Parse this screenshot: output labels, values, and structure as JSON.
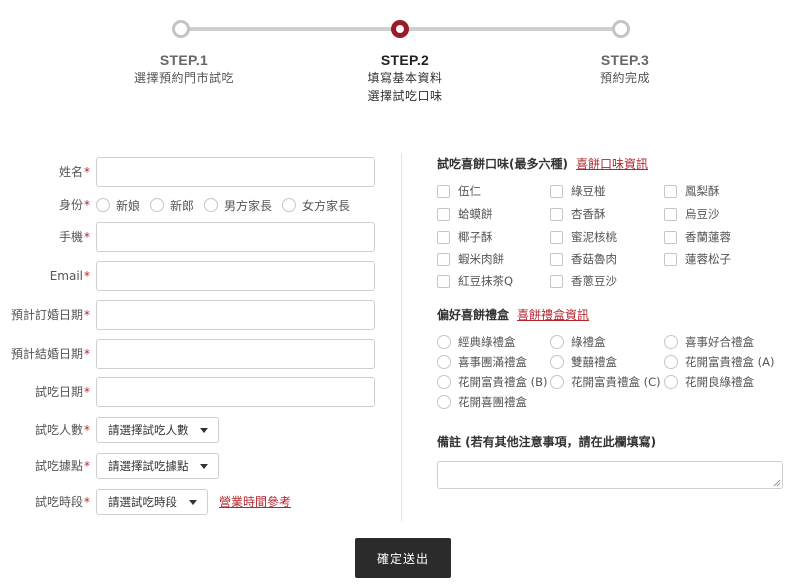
{
  "steps": [
    {
      "title": "STEP.1",
      "sub1": "選擇預約門市試吃",
      "sub2": ""
    },
    {
      "title": "STEP.2",
      "sub1": "填寫基本資料",
      "sub2": "選擇試吃口味"
    },
    {
      "title": "STEP.3",
      "sub1": "預約完成",
      "sub2": ""
    }
  ],
  "active_step": 2,
  "form": {
    "name_label": "姓名",
    "identity_label": "身份",
    "identity_options": [
      "新娘",
      "新郎",
      "男方家長",
      "女方家長"
    ],
    "phone_label": "手機",
    "email_label": "Email",
    "engage_date_label": "預計訂婚日期",
    "wedding_date_label": "預計結婚日期",
    "tasting_date_label": "試吃日期",
    "people_label": "試吃人數",
    "people_placeholder": "請選擇試吃人數",
    "location_label": "試吃據點",
    "location_placeholder": "請選擇試吃據點",
    "timeslot_label": "試吃時段",
    "timeslot_placeholder": "請選試吃時段",
    "hours_link": "營業時間參考",
    "required_mark": "*"
  },
  "flavors": {
    "title": "試吃喜餅口味(最多六種)",
    "link": "喜餅口味資訊",
    "items": [
      "伍仁",
      "綠豆椪",
      "鳳梨酥",
      "蛤蟆餅",
      "杏香酥",
      "烏豆沙",
      "椰子酥",
      "蜜泥核桃",
      "香蘭蓮蓉",
      "蝦米肉餅",
      "香菇魯肉",
      "蓮蓉松子",
      "紅豆抹茶Q",
      "香蔥豆沙"
    ]
  },
  "boxes": {
    "title": "偏好喜餅禮盒",
    "link": "喜餅禮盒資訊",
    "items": [
      "經典綠禮盒",
      "綠禮盒",
      "喜事好合禮盒",
      "喜事團滿禮盒",
      "雙囍禮盒",
      "花開富貴禮盒 (A)",
      "花開富貴禮盒 (B)",
      "花開富貴禮盒 (C)",
      "花開良綠禮盒",
      "花開喜團禮盒"
    ]
  },
  "notes": {
    "title": "備註 (若有其他注意事項，請在此欄填寫)"
  },
  "submit_label": "確定送出",
  "colors": {
    "accent": "#b3262f",
    "active_step": "#9b1c28",
    "button": "#2b2b2b"
  }
}
